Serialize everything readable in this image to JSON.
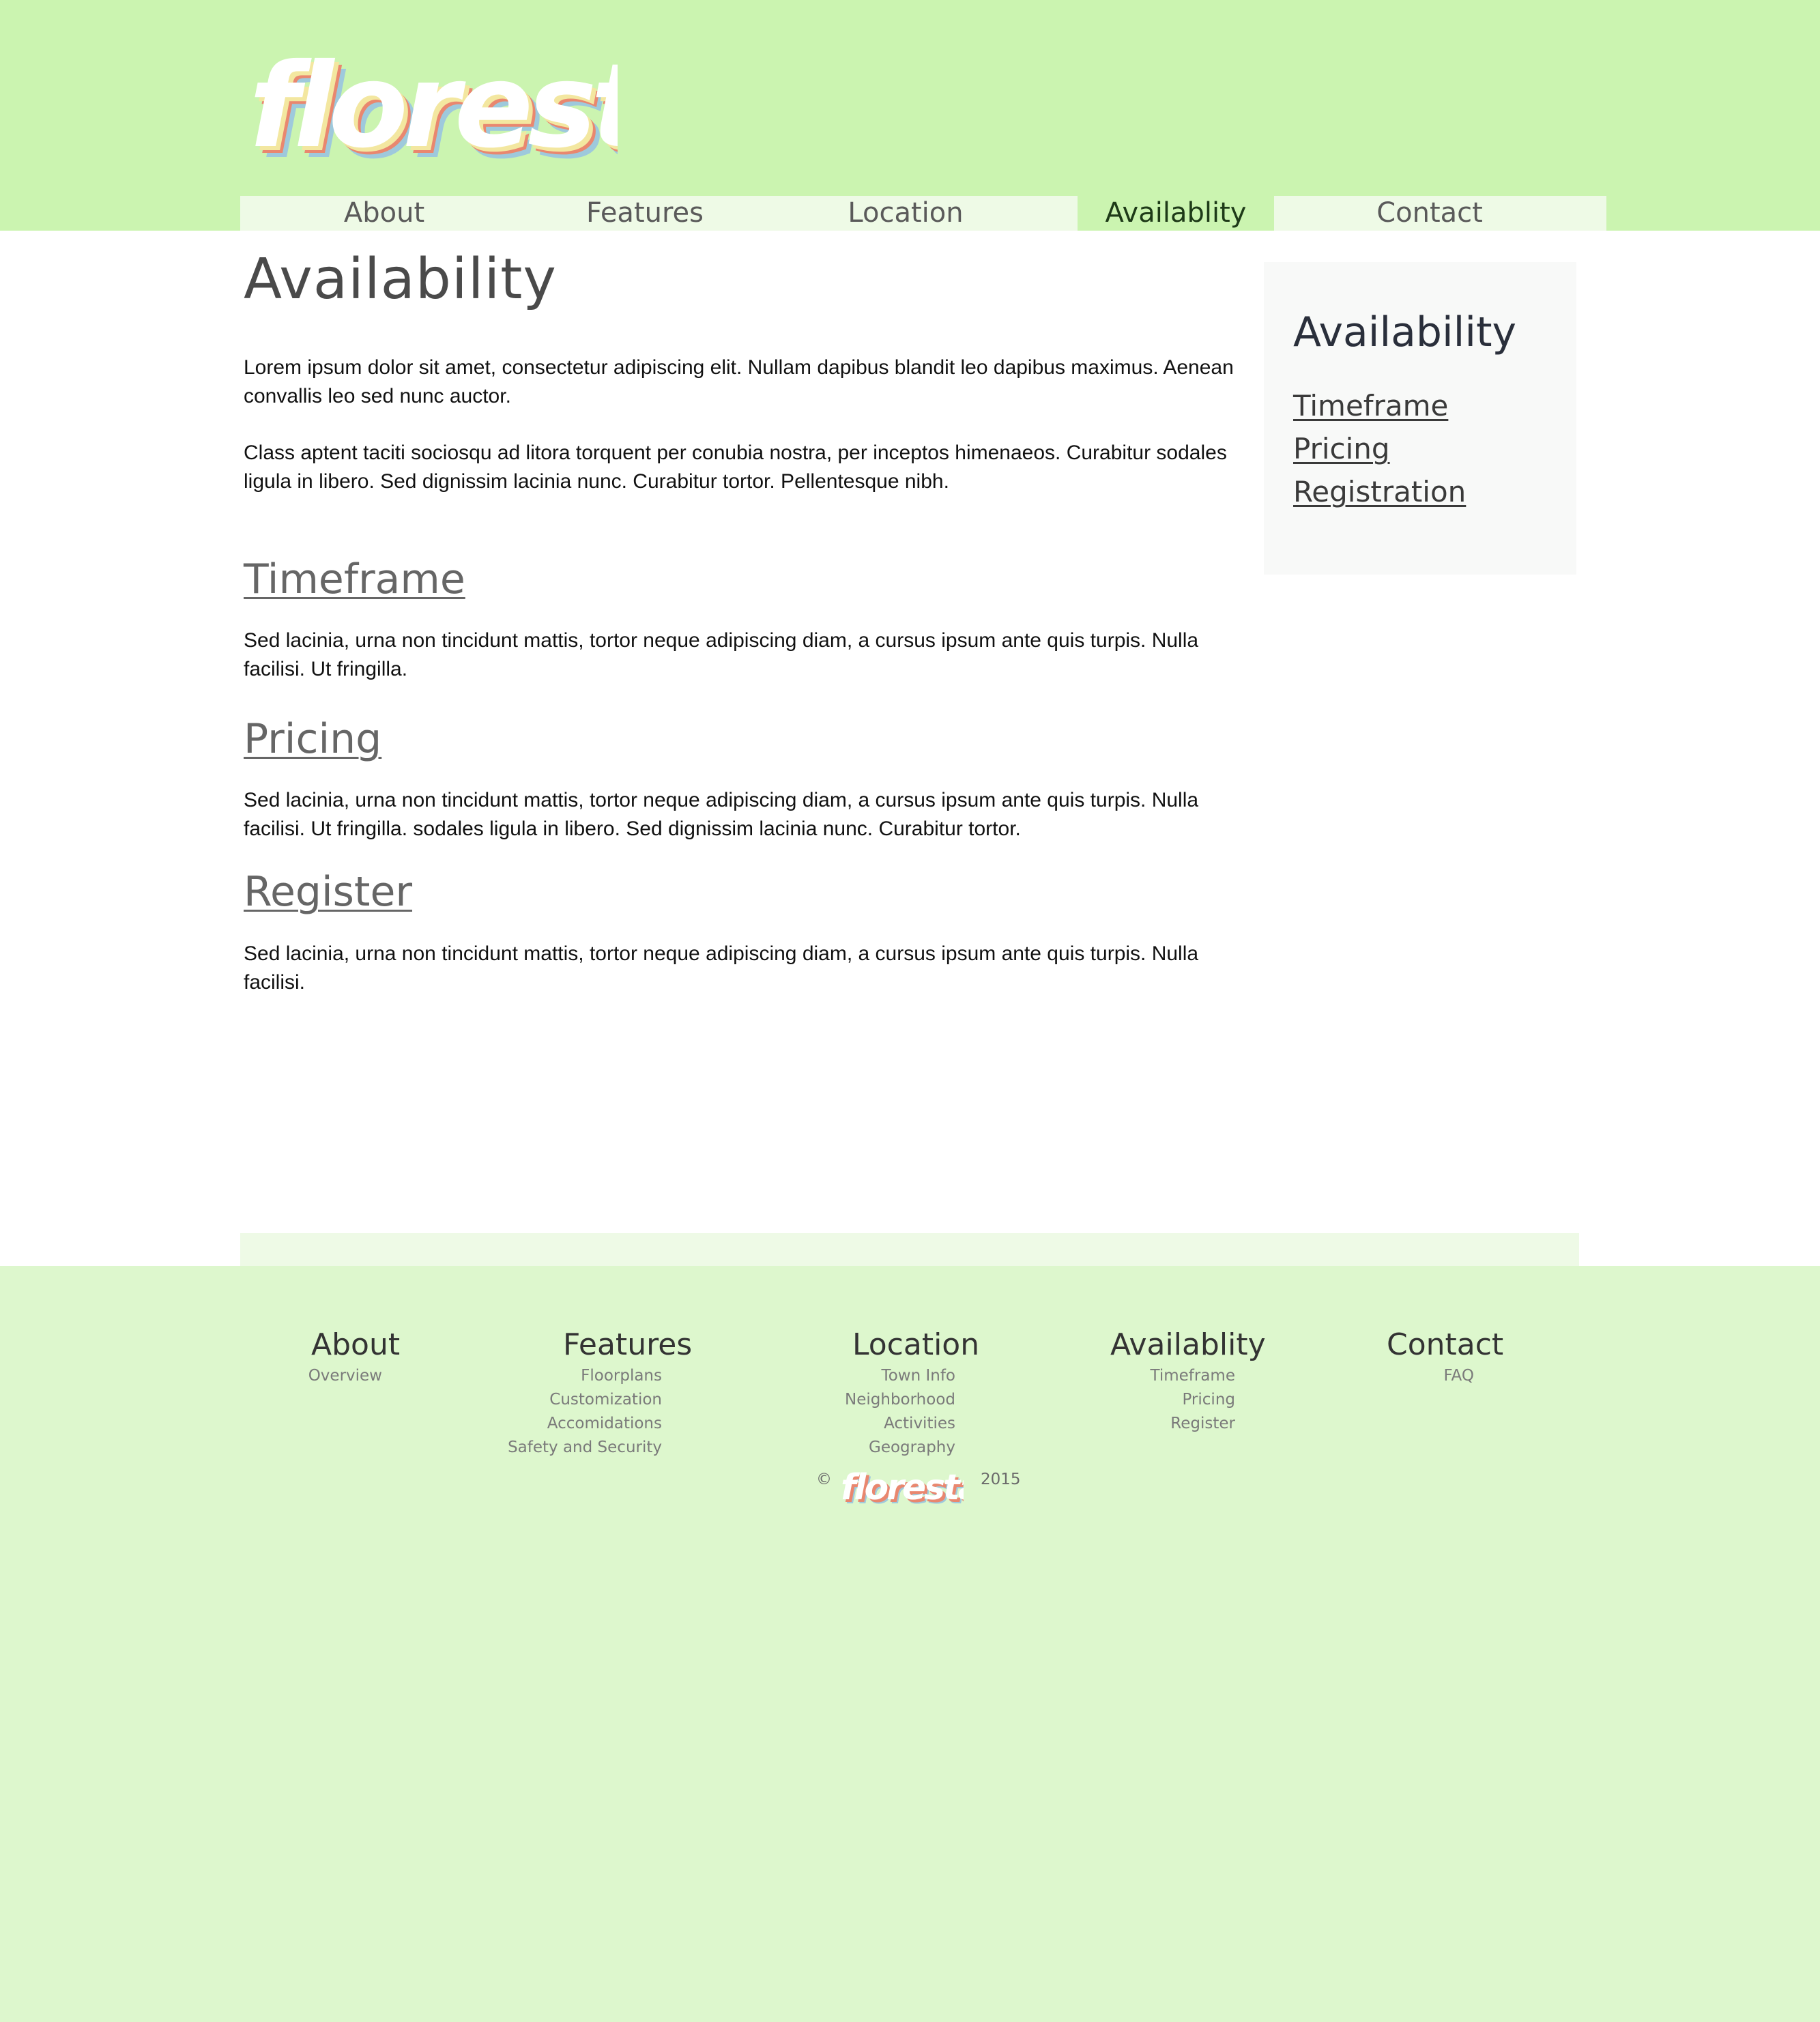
{
  "brand": {
    "name": "floresta"
  },
  "nav": [
    {
      "label": "About"
    },
    {
      "label": "Features"
    },
    {
      "label": "Location"
    },
    {
      "label": "Availablity",
      "active": true
    },
    {
      "label": "Contact"
    }
  ],
  "main": {
    "title": "Availability",
    "intro": [
      "Lorem ipsum dolor sit amet, consectetur adipiscing elit. Nullam dapibus blandit leo dapibus maximus. Aenean convallis leo sed nunc auctor.",
      "Class aptent taciti sociosqu ad litora torquent per conubia nostra, per inceptos himenaeos. Curabitur sodales ligula in libero. Sed dignissim lacinia nunc. Curabitur tortor. Pellentesque nibh."
    ],
    "sections": [
      {
        "title": "Timeframe",
        "body": "Sed lacinia, urna non tincidunt mattis, tortor neque adipiscing diam, a cursus ipsum ante quis turpis. Nulla facilisi. Ut fringilla."
      },
      {
        "title": "Pricing",
        "body": "Sed lacinia, urna non tincidunt mattis, tortor neque adipiscing diam, a cursus ipsum ante quis turpis. Nulla facilisi. Ut fringilla.   sodales ligula in libero. Sed dignissim lacinia nunc. Curabitur tortor."
      },
      {
        "title": "Register",
        "body": "Sed lacinia, urna non tincidunt mattis, tortor neque adipiscing diam, a cursus ipsum ante quis turpis. Nulla facilisi."
      }
    ]
  },
  "sidebar": {
    "title": "Availability",
    "links": [
      "Timeframe",
      "Pricing",
      "Registration"
    ]
  },
  "footer": {
    "columns": [
      {
        "title": "About",
        "links": [
          "Overview"
        ]
      },
      {
        "title": "Features",
        "links": [
          "Floorplans",
          "Customization",
          "Accomidations",
          "Safety and Security"
        ]
      },
      {
        "title": "Location",
        "links": [
          "Town Info",
          "Neighborhood",
          "Activities",
          "Geography"
        ]
      },
      {
        "title": "Availablity",
        "links": [
          "Timeframe",
          "Pricing",
          "Register"
        ]
      },
      {
        "title": "Contact",
        "links": [
          "FAQ"
        ]
      }
    ],
    "copyright_symbol": "©",
    "year": "2015"
  },
  "colors": {
    "header_bg": "#cbf4b0",
    "nav_bg": "#eefae6",
    "footer_bg": "#ddf7cd",
    "logo_shadow_red": "#e9876f",
    "logo_shadow_blue": "#9ec9dc"
  }
}
